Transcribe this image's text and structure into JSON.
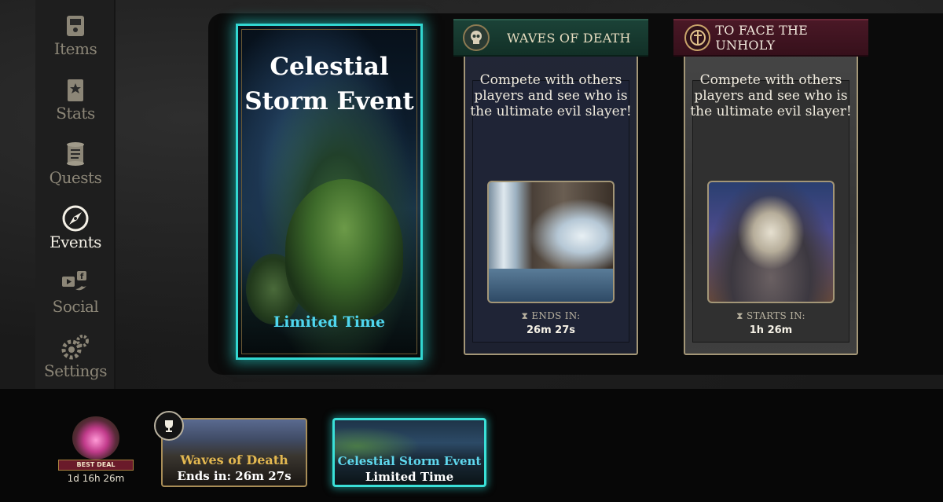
{
  "sidebar": {
    "items": [
      {
        "label": "Items",
        "icon": "items-icon"
      },
      {
        "label": "Stats",
        "icon": "stats-icon"
      },
      {
        "label": "Quests",
        "icon": "quests-icon"
      },
      {
        "label": "Events",
        "icon": "compass-icon",
        "active": true
      },
      {
        "label": "Social",
        "icon": "social-icon"
      },
      {
        "label": "Settings",
        "icon": "gear-icon"
      }
    ]
  },
  "featured_event": {
    "title": "Celestial Storm Event",
    "footer": "Limited Time"
  },
  "events": [
    {
      "name": "WAVES OF DEATH",
      "emblem": "skull-icon",
      "description": "Compete with others players and see who is the ultimate evil slayer!",
      "timer_label": "ENDS IN:",
      "timer_value": "26m 27s",
      "timer_icon": "hourglass-icon"
    },
    {
      "name": "TO FACE THE UNHOLY",
      "emblem": "sword-emblem-icon",
      "description": "Compete with others players and see who is the ultimate evil slayer!",
      "timer_label": "STARTS IN:",
      "timer_value": "1h 26m",
      "timer_icon": "hourglass-icon"
    }
  ],
  "bottom_bar": {
    "best_deal": {
      "label": "BEST DEAL",
      "time": "1d 16h 26m"
    },
    "tiles": [
      {
        "title": "Waves of Death",
        "subtitle": "Ends in: 26m 27s"
      },
      {
        "title": "Celestial Storm Event",
        "subtitle": "Limited Time"
      }
    ]
  },
  "colors": {
    "accent_cyan": "#32d7d1",
    "gold_border": "#a39677",
    "ribbon_green": "#1b4237",
    "ribbon_red": "#4a1826"
  }
}
